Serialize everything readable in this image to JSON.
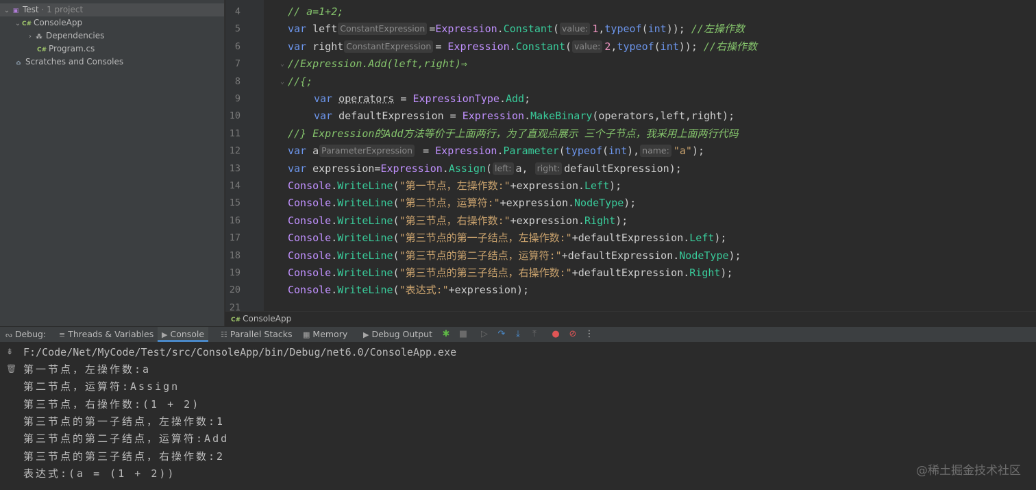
{
  "sidebar": {
    "items": [
      {
        "label": "Test",
        "extra": "· 1 project"
      },
      {
        "label": "ConsoleApp"
      },
      {
        "label": "Dependencies"
      },
      {
        "label": "Program.cs"
      },
      {
        "label": "Scratches and Consoles"
      }
    ]
  },
  "editor": {
    "lines": [
      {
        "num": "4",
        "segs": [
          {
            "t": "// a=1+2;",
            "c": "cmt"
          }
        ]
      },
      {
        "num": "5",
        "segs": [
          {
            "t": "var",
            "c": "kw"
          },
          {
            "t": " left",
            "c": "def"
          },
          {
            "t": "ConstantExpression",
            "c": "hint"
          },
          {
            "t": "=",
            "c": "def"
          },
          {
            "t": "Expression",
            "c": "cls"
          },
          {
            "t": ".",
            "c": "def"
          },
          {
            "t": "Constant",
            "c": "mth"
          },
          {
            "t": "(",
            "c": "def"
          },
          {
            "t": "value:",
            "c": "hint"
          },
          {
            "t": "1",
            "c": "num"
          },
          {
            "t": ",",
            "c": "def"
          },
          {
            "t": "typeof",
            "c": "kw"
          },
          {
            "t": "(",
            "c": "def"
          },
          {
            "t": "int",
            "c": "kw"
          },
          {
            "t": ")); ",
            "c": "def"
          },
          {
            "t": "//左操作数",
            "c": "cmt"
          }
        ]
      },
      {
        "num": "6",
        "segs": [
          {
            "t": "var",
            "c": "kw"
          },
          {
            "t": " right",
            "c": "def"
          },
          {
            "t": "ConstantExpression",
            "c": "hint"
          },
          {
            "t": "= ",
            "c": "def"
          },
          {
            "t": "Expression",
            "c": "cls"
          },
          {
            "t": ".",
            "c": "def"
          },
          {
            "t": "Constant",
            "c": "mth"
          },
          {
            "t": "(",
            "c": "def"
          },
          {
            "t": "value:",
            "c": "hint"
          },
          {
            "t": "2",
            "c": "num"
          },
          {
            "t": ",",
            "c": "def"
          },
          {
            "t": "typeof",
            "c": "kw"
          },
          {
            "t": "(",
            "c": "def"
          },
          {
            "t": "int",
            "c": "kw"
          },
          {
            "t": ")); ",
            "c": "def"
          },
          {
            "t": "//右操作数",
            "c": "cmt"
          }
        ]
      },
      {
        "num": "7",
        "fold": true,
        "segs": [
          {
            "t": "//Expression.Add(left,right)⇒",
            "c": "cmt"
          }
        ]
      },
      {
        "num": "8",
        "fold": true,
        "segs": [
          {
            "t": "//{;",
            "c": "cmt"
          }
        ]
      },
      {
        "num": "9",
        "indent": true,
        "segs": [
          {
            "t": "var",
            "c": "kw"
          },
          {
            "t": " ",
            "c": "def"
          },
          {
            "t": "operators",
            "c": "def squiggle"
          },
          {
            "t": " = ",
            "c": "def"
          },
          {
            "t": "ExpressionType",
            "c": "cls"
          },
          {
            "t": ".",
            "c": "def"
          },
          {
            "t": "Add",
            "c": "mth"
          },
          {
            "t": ";",
            "c": "def"
          }
        ]
      },
      {
        "num": "10",
        "indent": true,
        "segs": [
          {
            "t": "var",
            "c": "kw"
          },
          {
            "t": " defaultExpression = ",
            "c": "def"
          },
          {
            "t": "Expression",
            "c": "cls"
          },
          {
            "t": ".",
            "c": "def"
          },
          {
            "t": "MakeBinary",
            "c": "mth"
          },
          {
            "t": "(operators,left,right);",
            "c": "def"
          }
        ]
      },
      {
        "num": "11",
        "segs": [
          {
            "t": "//} Expression的Add方法等价于上面两行，为了直观点展示 三个子节点，我采用上面两行代码",
            "c": "cmt"
          }
        ]
      },
      {
        "num": "12",
        "segs": [
          {
            "t": "var",
            "c": "kw"
          },
          {
            "t": " a",
            "c": "def"
          },
          {
            "t": "ParameterExpression",
            "c": "hint"
          },
          {
            "t": " = ",
            "c": "def"
          },
          {
            "t": "Expression",
            "c": "cls"
          },
          {
            "t": ".",
            "c": "def"
          },
          {
            "t": "Parameter",
            "c": "mth"
          },
          {
            "t": "(",
            "c": "def"
          },
          {
            "t": "typeof",
            "c": "kw"
          },
          {
            "t": "(",
            "c": "def"
          },
          {
            "t": "int",
            "c": "kw"
          },
          {
            "t": "),",
            "c": "def"
          },
          {
            "t": "name:",
            "c": "hint"
          },
          {
            "t": "\"a\"",
            "c": "str"
          },
          {
            "t": ");",
            "c": "def"
          }
        ]
      },
      {
        "num": "13",
        "segs": [
          {
            "t": "var",
            "c": "kw"
          },
          {
            "t": " expression=",
            "c": "def"
          },
          {
            "t": "Expression",
            "c": "cls"
          },
          {
            "t": ".",
            "c": "def"
          },
          {
            "t": "Assign",
            "c": "mth"
          },
          {
            "t": "(",
            "c": "def"
          },
          {
            "t": "left:",
            "c": "hint"
          },
          {
            "t": "a, ",
            "c": "def"
          },
          {
            "t": "right:",
            "c": "hint"
          },
          {
            "t": "defaultExpression);",
            "c": "def"
          }
        ]
      },
      {
        "num": "14",
        "segs": [
          {
            "t": "Console",
            "c": "cls"
          },
          {
            "t": ".",
            "c": "def"
          },
          {
            "t": "WriteLine",
            "c": "mth"
          },
          {
            "t": "(",
            "c": "def"
          },
          {
            "t": "\"第一节点，左操作数:\"",
            "c": "str"
          },
          {
            "t": "+expression.",
            "c": "def"
          },
          {
            "t": "Left",
            "c": "mth"
          },
          {
            "t": ");",
            "c": "def"
          }
        ]
      },
      {
        "num": "15",
        "segs": [
          {
            "t": "Console",
            "c": "cls"
          },
          {
            "t": ".",
            "c": "def"
          },
          {
            "t": "WriteLine",
            "c": "mth"
          },
          {
            "t": "(",
            "c": "def"
          },
          {
            "t": "\"第二节点，运算符:\"",
            "c": "str"
          },
          {
            "t": "+expression.",
            "c": "def"
          },
          {
            "t": "NodeType",
            "c": "mth"
          },
          {
            "t": ");",
            "c": "def"
          }
        ]
      },
      {
        "num": "16",
        "segs": [
          {
            "t": "Console",
            "c": "cls"
          },
          {
            "t": ".",
            "c": "def"
          },
          {
            "t": "WriteLine",
            "c": "mth"
          },
          {
            "t": "(",
            "c": "def"
          },
          {
            "t": "\"第三节点，右操作数:\"",
            "c": "str"
          },
          {
            "t": "+expression.",
            "c": "def"
          },
          {
            "t": "Right",
            "c": "mth"
          },
          {
            "t": ");",
            "c": "def"
          }
        ]
      },
      {
        "num": "17",
        "segs": [
          {
            "t": "Console",
            "c": "cls"
          },
          {
            "t": ".",
            "c": "def"
          },
          {
            "t": "WriteLine",
            "c": "mth"
          },
          {
            "t": "(",
            "c": "def"
          },
          {
            "t": "\"第三节点的第一子结点，左操作数:\"",
            "c": "str"
          },
          {
            "t": "+defaultExpression.",
            "c": "def"
          },
          {
            "t": "Left",
            "c": "mth"
          },
          {
            "t": ");",
            "c": "def"
          }
        ]
      },
      {
        "num": "18",
        "segs": [
          {
            "t": "Console",
            "c": "cls"
          },
          {
            "t": ".",
            "c": "def"
          },
          {
            "t": "WriteLine",
            "c": "mth"
          },
          {
            "t": "(",
            "c": "def"
          },
          {
            "t": "\"第三节点的第二子结点，运算符:\"",
            "c": "str"
          },
          {
            "t": "+defaultExpression.",
            "c": "def"
          },
          {
            "t": "NodeType",
            "c": "mth"
          },
          {
            "t": ");",
            "c": "def"
          }
        ]
      },
      {
        "num": "19",
        "segs": [
          {
            "t": "Console",
            "c": "cls"
          },
          {
            "t": ".",
            "c": "def"
          },
          {
            "t": "WriteLine",
            "c": "mth"
          },
          {
            "t": "(",
            "c": "def"
          },
          {
            "t": "\"第三节点的第三子结点，右操作数:\"",
            "c": "str"
          },
          {
            "t": "+defaultExpression.",
            "c": "def"
          },
          {
            "t": "Right",
            "c": "mth"
          },
          {
            "t": ");",
            "c": "def"
          }
        ]
      },
      {
        "num": "20",
        "segs": [
          {
            "t": "Console",
            "c": "cls"
          },
          {
            "t": ".",
            "c": "def"
          },
          {
            "t": "WriteLine",
            "c": "mth"
          },
          {
            "t": "(",
            "c": "def"
          },
          {
            "t": "\"表达式:\"",
            "c": "str"
          },
          {
            "t": "+expression);",
            "c": "def"
          }
        ]
      },
      {
        "num": "21",
        "segs": []
      }
    ]
  },
  "breadcrumb": {
    "label": "ConsoleApp"
  },
  "debug": {
    "title": "Debug:",
    "tabs": [
      "Threads & Variables",
      "Console",
      "Parallel Stacks",
      "Memory",
      "Debug Output"
    ]
  },
  "console": {
    "lines": [
      "F:/Code/Net/MyCode/Test/src/ConsoleApp/bin/Debug/net6.0/ConsoleApp.exe",
      "第一节点，左操作数:a",
      "第二节点，运算符:Assign",
      "第三节点，右操作数:(1 + 2)",
      "第三节点的第一子结点，左操作数:1",
      "第三节点的第二子结点，运算符:Add",
      "第三节点的第三子结点，右操作数:2",
      "表达式:(a = (1 + 2))"
    ]
  },
  "watermark": "@稀土掘金技术社区",
  "colors": {
    "keyword": "#6c95eb",
    "class": "#c191ff",
    "method": "#39cc9b",
    "string": "#c9a26d",
    "number": "#ed94c0",
    "comment": "#85c46c",
    "accent": "#4a88c7"
  },
  "icons": [
    "project-icon",
    "csharp-project-icon",
    "dependencies-icon",
    "csharp-file-icon",
    "scratches-icon",
    "debug-icon",
    "threads-icon",
    "console-icon",
    "parallel-stacks-icon",
    "memory-icon",
    "debug-output-icon",
    "bug-icon",
    "stop-icon",
    "resume-icon",
    "step-over-icon",
    "step-into-icon",
    "step-out-icon",
    "view-breakpoints-icon",
    "mute-breakpoints-icon",
    "more-icon"
  ]
}
